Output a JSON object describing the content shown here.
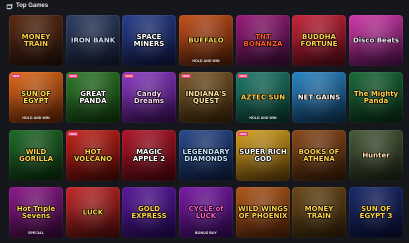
{
  "header": {
    "title": "Top Games",
    "icon": "slot-machine-icon"
  },
  "colors": {
    "page_background": "#15171d",
    "badge": "#e23b6f"
  },
  "games": [
    {
      "name": "MONEY TRAIN",
      "sub": "",
      "badge": "",
      "bg": [
        "#5a2a14",
        "#1a0c06"
      ],
      "tc": "#ffcf3f"
    },
    {
      "name": "IRON BANK",
      "sub": "",
      "badge": "",
      "bg": [
        "#2e3f63",
        "#0d1424"
      ],
      "tc": "#cfe0ff"
    },
    {
      "name": "SPACE MINERS",
      "sub": "",
      "badge": "",
      "bg": [
        "#2a3f8a",
        "#0a1030"
      ],
      "tc": "#ffffff"
    },
    {
      "name": "BUFFALO",
      "sub": "HOLD AND WIN",
      "badge": "",
      "bg": [
        "#c4501a",
        "#3a1506"
      ],
      "tc": "#ffd24a"
    },
    {
      "name": "TNT BONANZA",
      "sub": "",
      "badge": "",
      "bg": [
        "#9a1c7a",
        "#2a0a28"
      ],
      "tc": "#ff5a2a"
    },
    {
      "name": "BUDDHA FORTUNE",
      "sub": "",
      "badge": "",
      "bg": [
        "#c6243a",
        "#400812"
      ],
      "tc": "#ffd24a"
    },
    {
      "name": "Disco Beats",
      "sub": "",
      "badge": "",
      "bg": [
        "#d13aa8",
        "#3a0a3a"
      ],
      "tc": "#ffe6ff"
    },
    {
      "name": "SUN OF EGYPT",
      "sub": "HOLD AND WIN",
      "badge": "NEW",
      "bg": [
        "#e06a1a",
        "#4a1a04"
      ],
      "tc": "#ffe04a"
    },
    {
      "name": "GREAT PANDA",
      "sub": "",
      "badge": "NEW",
      "bg": [
        "#2f7a2a",
        "#0c2a0a"
      ],
      "tc": "#ffffff"
    },
    {
      "name": "Candy Dreams",
      "sub": "",
      "badge": "NEW",
      "bg": [
        "#8a3ac4",
        "#2a0a40"
      ],
      "tc": "#ffd6ff"
    },
    {
      "name": "INDIANA'S QUEST",
      "sub": "",
      "badge": "NEW",
      "bg": [
        "#7a5a2a",
        "#2a1a06"
      ],
      "tc": "#ffe29a"
    },
    {
      "name": "AZTEC SUN",
      "sub": "HOLD AND WIN",
      "badge": "NEW",
      "bg": [
        "#1f7a6a",
        "#062a22"
      ],
      "tc": "#ffd24a"
    },
    {
      "name": "NET GAINS",
      "sub": "",
      "badge": "",
      "bg": [
        "#2a86c4",
        "#0a2640"
      ],
      "tc": "#ffffff"
    },
    {
      "name": "The Mighty Panda",
      "sub": "",
      "badge": "",
      "bg": [
        "#1c6a3a",
        "#06200e"
      ],
      "tc": "#ffd24a"
    },
    {
      "name": "WILD GORILLA",
      "sub": "",
      "badge": "",
      "bg": [
        "#1f6a2a",
        "#082008"
      ],
      "tc": "#ffd24a"
    },
    {
      "name": "HOT VOLCANO",
      "sub": "",
      "badge": "NEW",
      "bg": [
        "#c4241a",
        "#3a0604"
      ],
      "tc": "#ffd24a"
    },
    {
      "name": "MAGIC APPLE 2",
      "sub": "",
      "badge": "",
      "bg": [
        "#b0162a",
        "#3a040a"
      ],
      "tc": "#ffffff"
    },
    {
      "name": "LEGENDARY DIAMONDS",
      "sub": "",
      "badge": "",
      "bg": [
        "#2a4a8a",
        "#0a1430"
      ],
      "tc": "#bfe4ff"
    },
    {
      "name": "SUPER RICH GOD",
      "sub": "",
      "badge": "NEW",
      "bg": [
        "#d4a020",
        "#4a3006"
      ],
      "tc": "#ffffff"
    },
    {
      "name": "BOOKS OF ATHENA",
      "sub": "",
      "badge": "",
      "bg": [
        "#8a4a1a",
        "#2a1406"
      ],
      "tc": "#ffd24a"
    },
    {
      "name": "Hunter",
      "sub": "",
      "badge": "",
      "bg": [
        "#4a5a3a",
        "#141a0e"
      ],
      "tc": "#ffe6b0"
    },
    {
      "name": "Hot Triple Sevens",
      "sub": "SPECIAL",
      "badge": "",
      "bg": [
        "#8a1a8a",
        "#2a062a"
      ],
      "tc": "#ffd24a"
    },
    {
      "name": "LUCK",
      "sub": "",
      "badge": "",
      "bg": [
        "#c42a2a",
        "#3a0808"
      ],
      "tc": "#ffd24a"
    },
    {
      "name": "GOLD EXPRESS",
      "sub": "",
      "badge": "",
      "bg": [
        "#5a1a9a",
        "#1a0640"
      ],
      "tc": "#ffd24a"
    },
    {
      "name": "CYCLE of LUCK",
      "sub": "BONUS BUY",
      "badge": "",
      "bg": [
        "#7a1aa4",
        "#240840"
      ],
      "tc": "#ff5ad0"
    },
    {
      "name": "WILD WINGS OF PHOENIX",
      "sub": "",
      "badge": "",
      "bg": [
        "#b0581a",
        "#3a1806"
      ],
      "tc": "#ffd24a"
    },
    {
      "name": "MONEY TRAIN",
      "sub": "",
      "badge": "",
      "bg": [
        "#6a4a1a",
        "#241806"
      ],
      "tc": "#ffd24a"
    },
    {
      "name": "SUN OF EGYPT 3",
      "sub": "",
      "badge": "",
      "bg": [
        "#1a2a6a",
        "#060a24"
      ],
      "tc": "#ffd24a"
    }
  ]
}
